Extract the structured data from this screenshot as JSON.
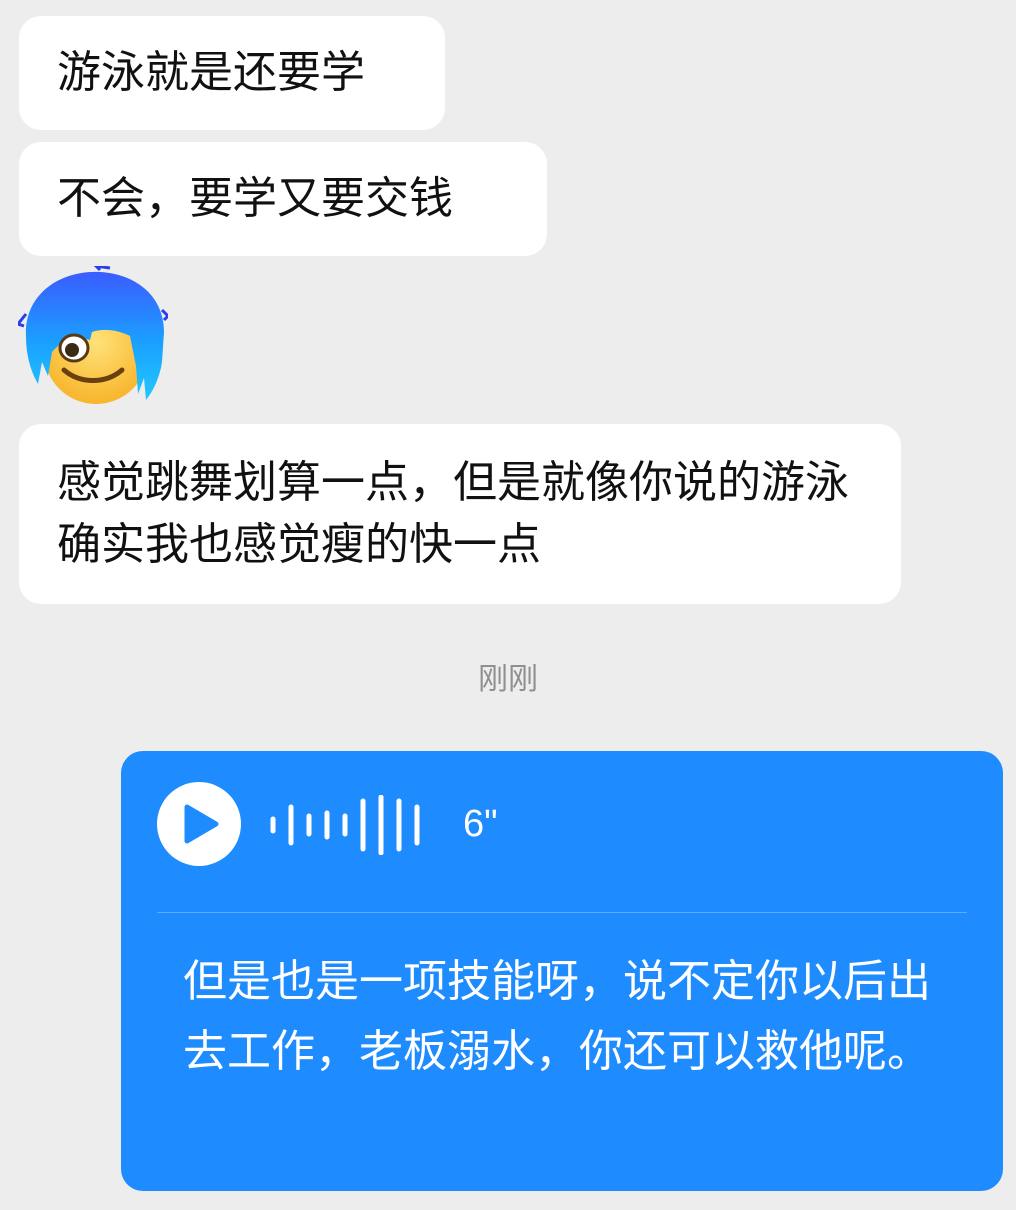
{
  "messages": [
    {
      "text": "游泳就是还要学"
    },
    {
      "text": "不会，要学又要交钱"
    },
    {
      "sticker": "blue-haired-smiling-face-sticker"
    },
    {
      "text": "感觉跳舞划算一点，但是就像你说的游泳确实我也感觉瘦的快一点"
    }
  ],
  "timestamp": "刚刚",
  "voice_message": {
    "duration": "6\"",
    "transcript": "但是也是一项技能呀，说不定你以后出去工作，老板溺水，你还可以救他呢。",
    "play_icon": "play-icon"
  },
  "colors": {
    "background": "#ededed",
    "incoming_bubble": "#ffffff",
    "outgoing_bubble": "#1e8cff",
    "timestamp_text": "#8f8f8f"
  }
}
